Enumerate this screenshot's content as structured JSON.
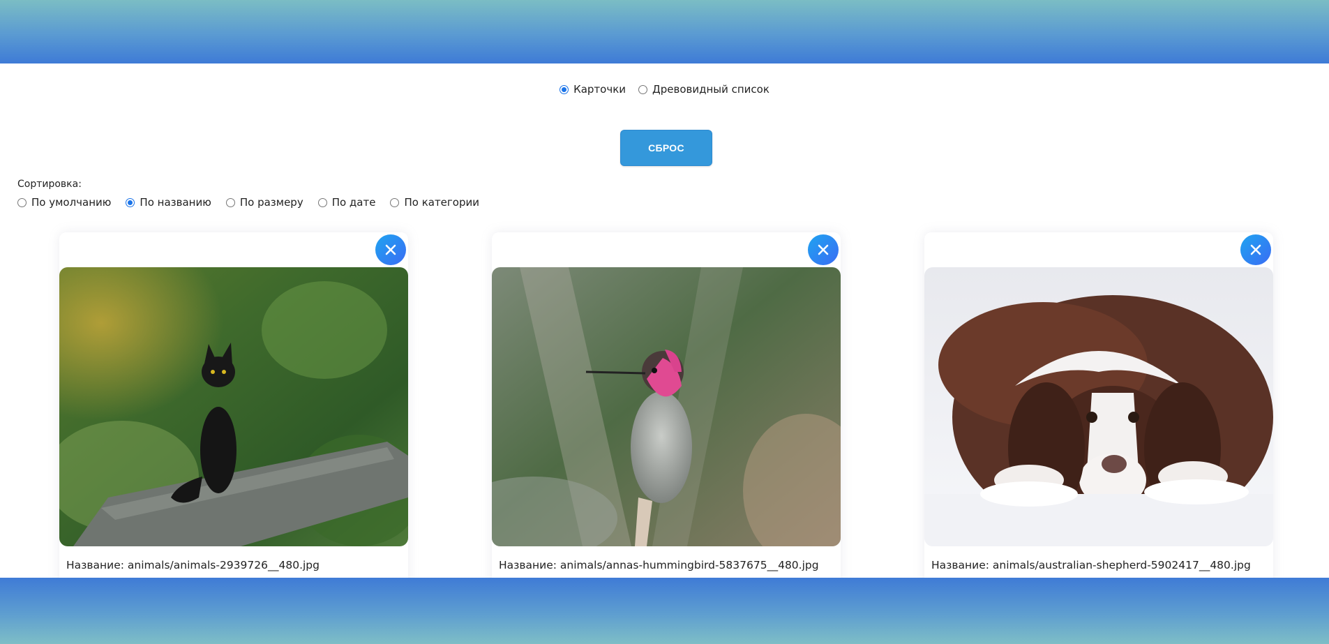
{
  "view_options": [
    {
      "label": "Карточки",
      "checked": true
    },
    {
      "label": "Древовидный список",
      "checked": false
    }
  ],
  "reset_button": {
    "label": "СБРОС"
  },
  "sort": {
    "title": "Сортировка:",
    "options": [
      {
        "label": "По умолчанию",
        "checked": false
      },
      {
        "label": "По названию",
        "checked": true
      },
      {
        "label": "По размеру",
        "checked": false
      },
      {
        "label": "По дате",
        "checked": false
      },
      {
        "label": "По категории",
        "checked": false
      }
    ]
  },
  "cards": [
    {
      "caption": "Название: animals/animals-2939726__480.jpg",
      "subject": "black cat in grass"
    },
    {
      "caption": "Название: animals/annas-hummingbird-5837675__480.jpg",
      "subject": "hummingbird"
    },
    {
      "caption": "Название: animals/australian-shepherd-5902417__480.jpg",
      "subject": "dog in snow"
    }
  ],
  "colors": {
    "accent": "#3498db",
    "radio_checked": "#1a73e8",
    "close_button": "#2a8af2"
  }
}
